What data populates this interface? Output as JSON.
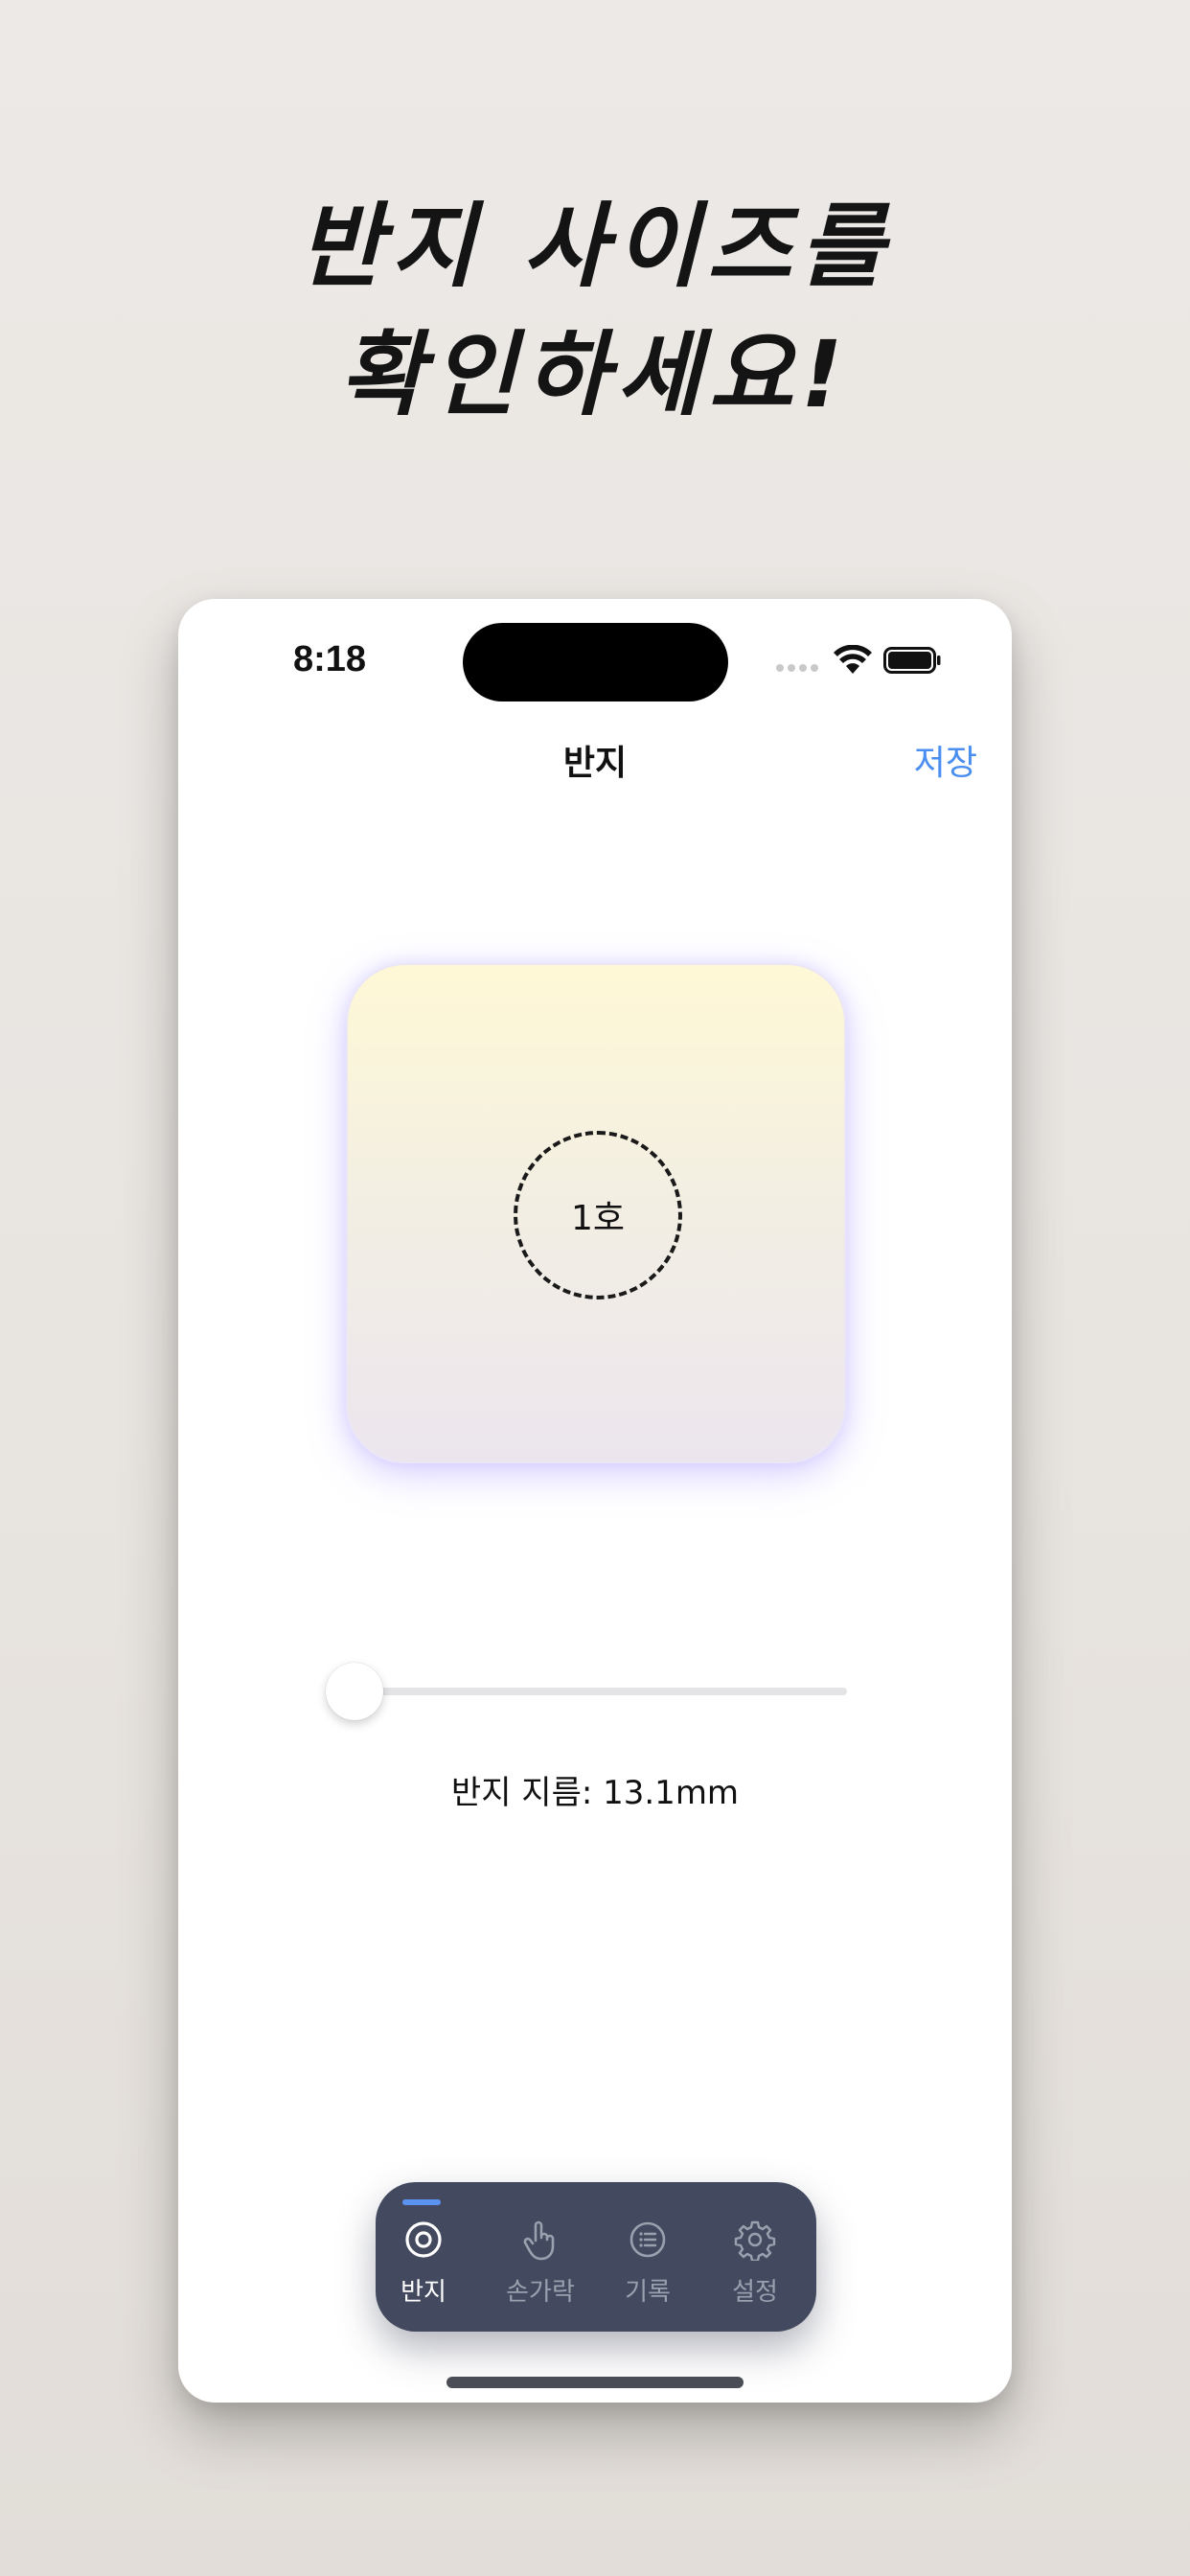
{
  "headline": {
    "line1": "반지 사이즈를",
    "line2": "확인하세요!"
  },
  "status_bar": {
    "time": "8:18"
  },
  "nav": {
    "title": "반지",
    "save_label": "저장"
  },
  "ring_preview": {
    "size_label": "1호"
  },
  "slider": {
    "value_fraction": 0.0
  },
  "diameter_text": "반지 지름: 13.1mm",
  "tab_bar": {
    "tabs": [
      {
        "label": "반지",
        "icon": "ring-icon",
        "active": true
      },
      {
        "label": "손가락",
        "icon": "hand-icon",
        "active": false
      },
      {
        "label": "기록",
        "icon": "list-icon",
        "active": false
      },
      {
        "label": "설정",
        "icon": "gear-icon",
        "active": false
      }
    ]
  },
  "colors": {
    "accent": "#4a8ef0",
    "tab_bar_bg": "#434a5f",
    "tab_indicator": "#5c93f0"
  }
}
